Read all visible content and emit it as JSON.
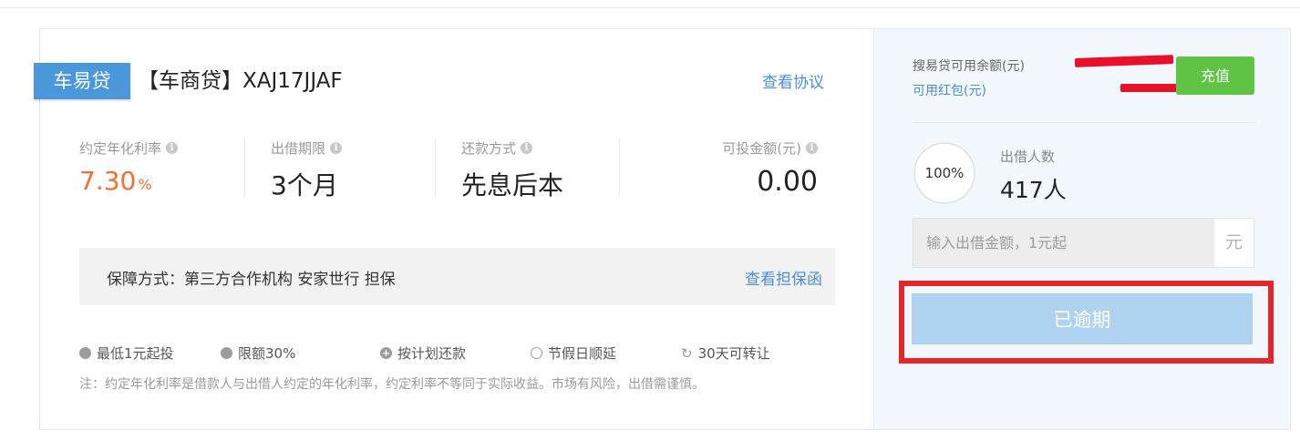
{
  "product": {
    "brand_tag": "车易贷",
    "title": "【车商贷】XAJ17JJAF",
    "view_agreement": "查看协议"
  },
  "stats": {
    "rate": {
      "label": "约定年化利率",
      "value": "7.30",
      "unit": "%"
    },
    "term": {
      "label": "出借期限",
      "value": "3个月"
    },
    "repay": {
      "label": "还款方式",
      "value": "先息后本"
    },
    "amount": {
      "label": "可投金额(元)",
      "value": "0.00"
    }
  },
  "guarantee": {
    "text": "保障方式：第三方合作机构 安家世行 担保",
    "link": "查看担保函"
  },
  "features": [
    {
      "icon": "info-circle-icon",
      "label": "最低1元起投"
    },
    {
      "icon": "pie-circle-icon",
      "label": "限额30%"
    },
    {
      "icon": "plus-circle-icon",
      "label": "按计划还款"
    },
    {
      "icon": "clock-icon",
      "label": "节假日顺延"
    },
    {
      "icon": "refresh-icon",
      "label": "30天可转让"
    }
  ],
  "note": "注：约定年化利率是借款人与出借人约定的年化利率，约定利率不等同于实际收益。市场有风险，出借需谨慎。",
  "account": {
    "balance_label": "搜易贷可用余额(元)",
    "redpack_label": "可用红包(元)",
    "recharge": "充值"
  },
  "progress": {
    "percent": 100,
    "percent_text": "100%"
  },
  "lenders": {
    "label": "出借人数",
    "value": "417人"
  },
  "invest_input": {
    "placeholder": "输入出借金额，1元起",
    "value": "",
    "unit": "元"
  },
  "action_button": "已逾期",
  "colors": {
    "brand_blue": "#4a97dc",
    "rate_orange": "#ef6f35",
    "recharge_green": "#5fc343",
    "disabled_button": "#afd2f0",
    "highlight_red": "#e4262c"
  }
}
